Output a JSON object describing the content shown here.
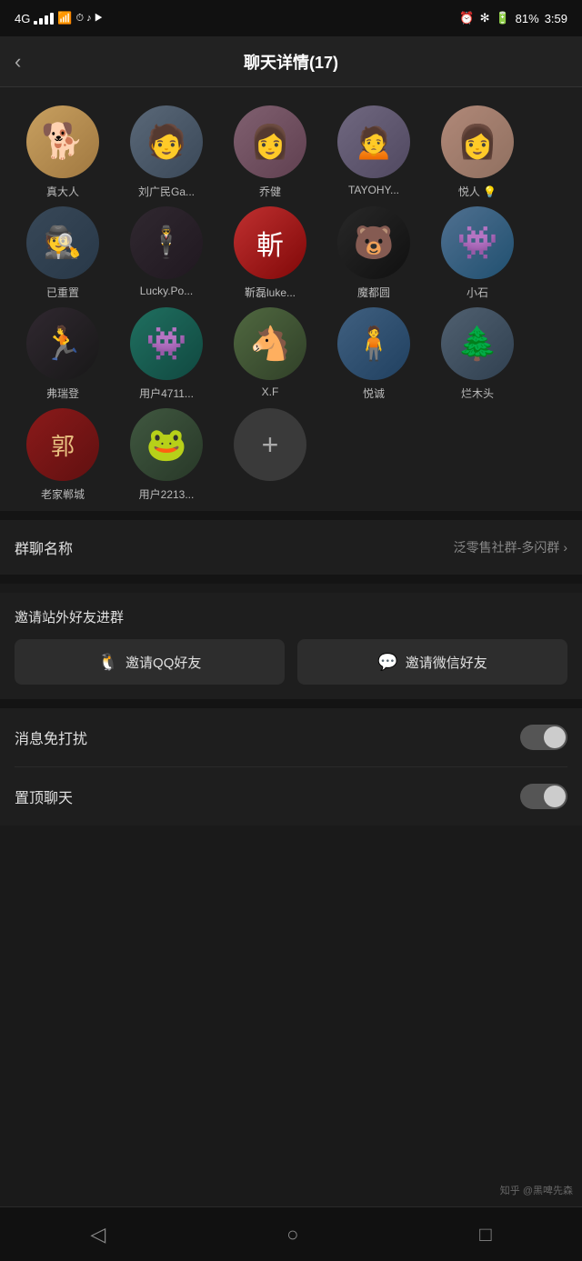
{
  "statusBar": {
    "signal": "4G",
    "time": "3:59",
    "battery": "81%"
  },
  "header": {
    "title": "聊天详情(17)",
    "backLabel": "‹"
  },
  "members": [
    {
      "name": "真大人",
      "avatar": "dog",
      "class": "av-dog",
      "emoji": "🐕"
    },
    {
      "name": "刘广民Ga...",
      "avatar": "person1",
      "class": "av-person1",
      "emoji": "🧑"
    },
    {
      "name": "乔健",
      "avatar": "girl1",
      "class": "av-girl1",
      "emoji": "👩"
    },
    {
      "name": "TAYOHY...",
      "avatar": "ancient",
      "class": "av-ancient",
      "emoji": "👘"
    },
    {
      "name": "悦人 💡",
      "avatar": "woman",
      "class": "av-woman",
      "emoji": "👩"
    },
    {
      "name": "已重置",
      "avatar": "hat",
      "class": "av-hat",
      "emoji": "🎩"
    },
    {
      "name": "Lucky.Po...",
      "avatar": "suit",
      "class": "av-suit",
      "emoji": "🕴"
    },
    {
      "name": "靳磊luke...",
      "avatar": "red",
      "class": "av-red",
      "emoji": "斬"
    },
    {
      "name": "魔都圆",
      "avatar": "bear",
      "class": "av-bear",
      "emoji": "🐻"
    },
    {
      "name": "小石",
      "avatar": "blue",
      "class": "av-blue",
      "emoji": "🔵"
    },
    {
      "name": "弗瑞登",
      "avatar": "run",
      "class": "av-run",
      "emoji": "🏃"
    },
    {
      "name": "用户4711...",
      "avatar": "monster",
      "class": "av-monster",
      "emoji": "👾"
    },
    {
      "name": "X.F",
      "avatar": "horse",
      "class": "av-horse",
      "emoji": "🐴"
    },
    {
      "name": "悦诚",
      "avatar": "stand",
      "class": "av-stand",
      "emoji": "🧍"
    },
    {
      "name": "烂木头",
      "avatar": "wood",
      "class": "av-wood",
      "emoji": "🌲"
    },
    {
      "name": "老家郸城",
      "avatar": "郭",
      "class": "av-郭",
      "emoji": "郭"
    },
    {
      "name": "用户2213...",
      "avatar": "frog",
      "class": "av-frog",
      "emoji": "🐸"
    }
  ],
  "addButton": {
    "label": "+"
  },
  "groupName": {
    "label": "群聊名称",
    "value": "泛零售社群-多闪群"
  },
  "inviteSection": {
    "title": "邀请站外好友进群",
    "qqLabel": "邀请QQ好友",
    "wechatLabel": "邀请微信好友"
  },
  "settings": [
    {
      "label": "消息免打扰",
      "type": "toggle",
      "on": false
    },
    {
      "label": "置顶聊天",
      "type": "toggle",
      "on": false
    }
  ],
  "bottomNav": [
    {
      "label": "",
      "icon": "◁"
    },
    {
      "label": "",
      "icon": "○"
    },
    {
      "label": "",
      "icon": "□"
    }
  ],
  "watermark": "知乎 @黑啤先森"
}
